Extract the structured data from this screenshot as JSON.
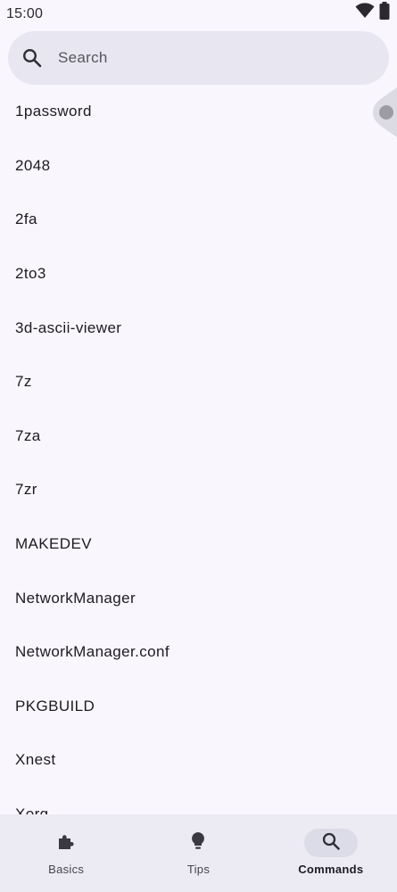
{
  "status_bar": {
    "time": "15:00",
    "icons": [
      "wifi-icon",
      "battery-icon"
    ]
  },
  "search": {
    "placeholder": "Search",
    "value": "",
    "icon": "search-icon"
  },
  "commands": [
    "1password",
    "2048",
    "2fa",
    "2to3",
    "3d-ascii-viewer",
    "7z",
    "7za",
    "7zr",
    "MAKEDEV",
    "NetworkManager",
    "NetworkManager.conf",
    "PKGBUILD",
    "Xnest",
    "Xorg"
  ],
  "bottom_nav": {
    "active": "commands",
    "items": [
      {
        "id": "basics",
        "label": "Basics",
        "icon": "puzzle-icon"
      },
      {
        "id": "tips",
        "label": "Tips",
        "icon": "lightbulb-icon"
      },
      {
        "id": "commands",
        "label": "Commands",
        "icon": "search-icon"
      }
    ]
  },
  "colors": {
    "background": "#f9f7fd",
    "search_bar": "#e8e7f1",
    "nav_background": "#ecebf3",
    "nav_indicator": "#dcdbe8",
    "text": "#1c1b20"
  }
}
